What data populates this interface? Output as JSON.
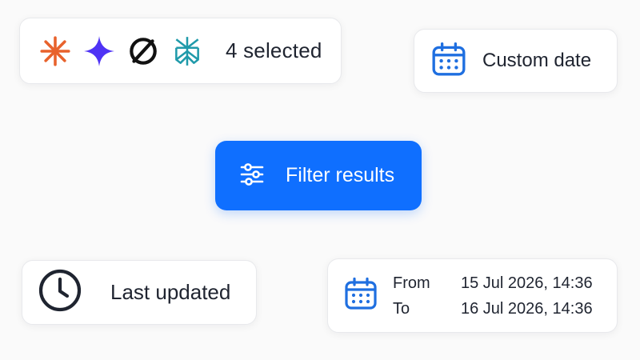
{
  "models_selector": {
    "label": "4 selected",
    "icons": [
      "claude-asterisk-icon",
      "gemini-sparkle-icon",
      "openai-knot-icon",
      "perplexity-icon"
    ],
    "icon_colors": [
      "#e8622c",
      "#4f33f5",
      "#111111",
      "#1f9aaa"
    ]
  },
  "custom_date": {
    "label": "Custom date",
    "icon": "calendar-icon",
    "icon_color": "#1f6fe0"
  },
  "filter_button": {
    "label": "Filter results",
    "icon": "sliders-icon",
    "background": "#0f6fff"
  },
  "last_updated": {
    "label": "Last updated",
    "icon": "clock-icon"
  },
  "date_range": {
    "icon": "calendar-icon",
    "from_label": "From",
    "from_value": "15 Jul 2026, 14:36",
    "to_label": "To",
    "to_value": "16 Jul 2026, 14:36"
  }
}
